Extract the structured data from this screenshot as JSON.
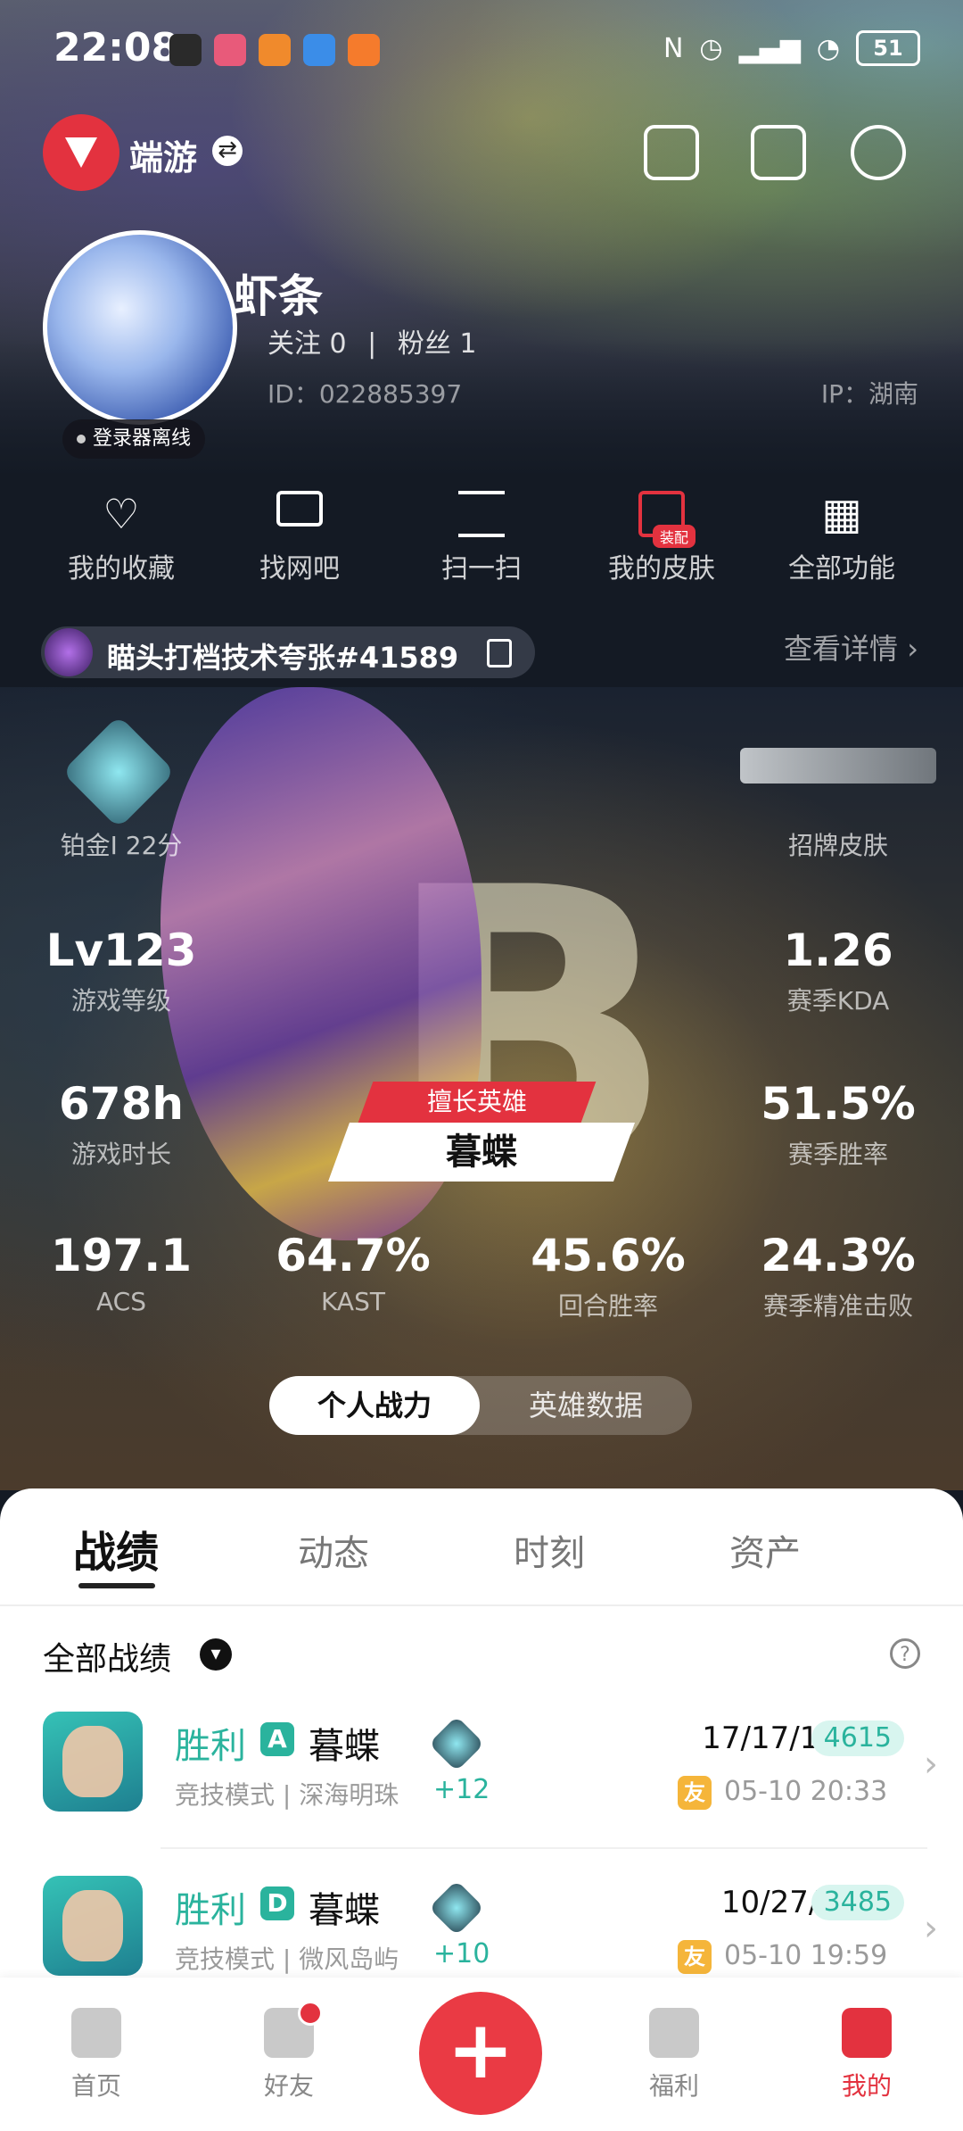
{
  "status_bar": {
    "time": "22:08",
    "battery": "51"
  },
  "header": {
    "mode_label": "端游",
    "mode_switch_icon": "swap-icon"
  },
  "profile": {
    "username": "虾条",
    "following_label": "关注 0",
    "followers_label": "粉丝 1",
    "separator": "|",
    "id": "ID：022885397",
    "ip": "IP：湖南",
    "online_status": "登录器离线"
  },
  "quick_actions": [
    {
      "label": "我的收藏",
      "icon": "heart-icon"
    },
    {
      "label": "找网吧",
      "icon": "monitor-icon"
    },
    {
      "label": "扫一扫",
      "icon": "scan-icon"
    },
    {
      "label": "我的皮肤",
      "icon": "skin-icon",
      "badge": "装配"
    },
    {
      "label": "全部功能",
      "icon": "grid-icon"
    }
  ],
  "riot": {
    "name": "瞄头打档技术夸张#41589",
    "details_link": "查看详情 ›"
  },
  "stats": {
    "rank_label": "铂金I 22分",
    "weapon_label": "招牌皮肤",
    "grade_letter": "B",
    "level": {
      "value": "Lv123",
      "label": "游戏等级"
    },
    "kda": {
      "value": "1.26",
      "label": "赛季KDA"
    },
    "hours": {
      "value": "678h",
      "label": "游戏时长"
    },
    "winrate": {
      "value": "51.5%",
      "label": "赛季胜率"
    },
    "hero_tag": "擅长英雄",
    "hero_name": "暮蝶",
    "acs": {
      "value": "197.1",
      "label": "ACS"
    },
    "kast": {
      "value": "64.7%",
      "label": "KAST"
    },
    "round_win": {
      "value": "45.6%",
      "label": "回合胜率"
    },
    "precision": {
      "value": "24.3%",
      "label": "赛季精准击败"
    }
  },
  "toggle": {
    "active": "个人战力",
    "inactive": "英雄数据"
  },
  "tabs": [
    "战绩",
    "动态",
    "时刻",
    "资产"
  ],
  "filter": {
    "label": "全部战绩",
    "help": "?"
  },
  "matches": [
    {
      "result": "胜利",
      "grade": "A",
      "agent": "暮蝶",
      "mode": "竞技模式 | 深海明珠",
      "delta": "+12",
      "kda": "17/17/12",
      "score": "4615",
      "friend": "友",
      "time": "05-10 20:33"
    },
    {
      "result": "胜利",
      "grade": "D",
      "agent": "暮蝶",
      "mode": "竞技模式 | 微风岛屿",
      "delta": "+10",
      "kda": "10/27/9",
      "score": "3485",
      "friend": "友",
      "time": "05-10 19:59"
    }
  ],
  "bottom_nav": [
    {
      "label": "首页",
      "icon": "home-icon"
    },
    {
      "label": "好友",
      "icon": "friends-icon"
    },
    {
      "label": "福利",
      "icon": "gift-icon"
    },
    {
      "label": "我的",
      "icon": "profile-icon"
    }
  ],
  "colors": {
    "accent": "#e3323f",
    "win": "#2ab39d",
    "score_bg": "#d8f5ef",
    "friend_badge": "#f5b53a"
  }
}
